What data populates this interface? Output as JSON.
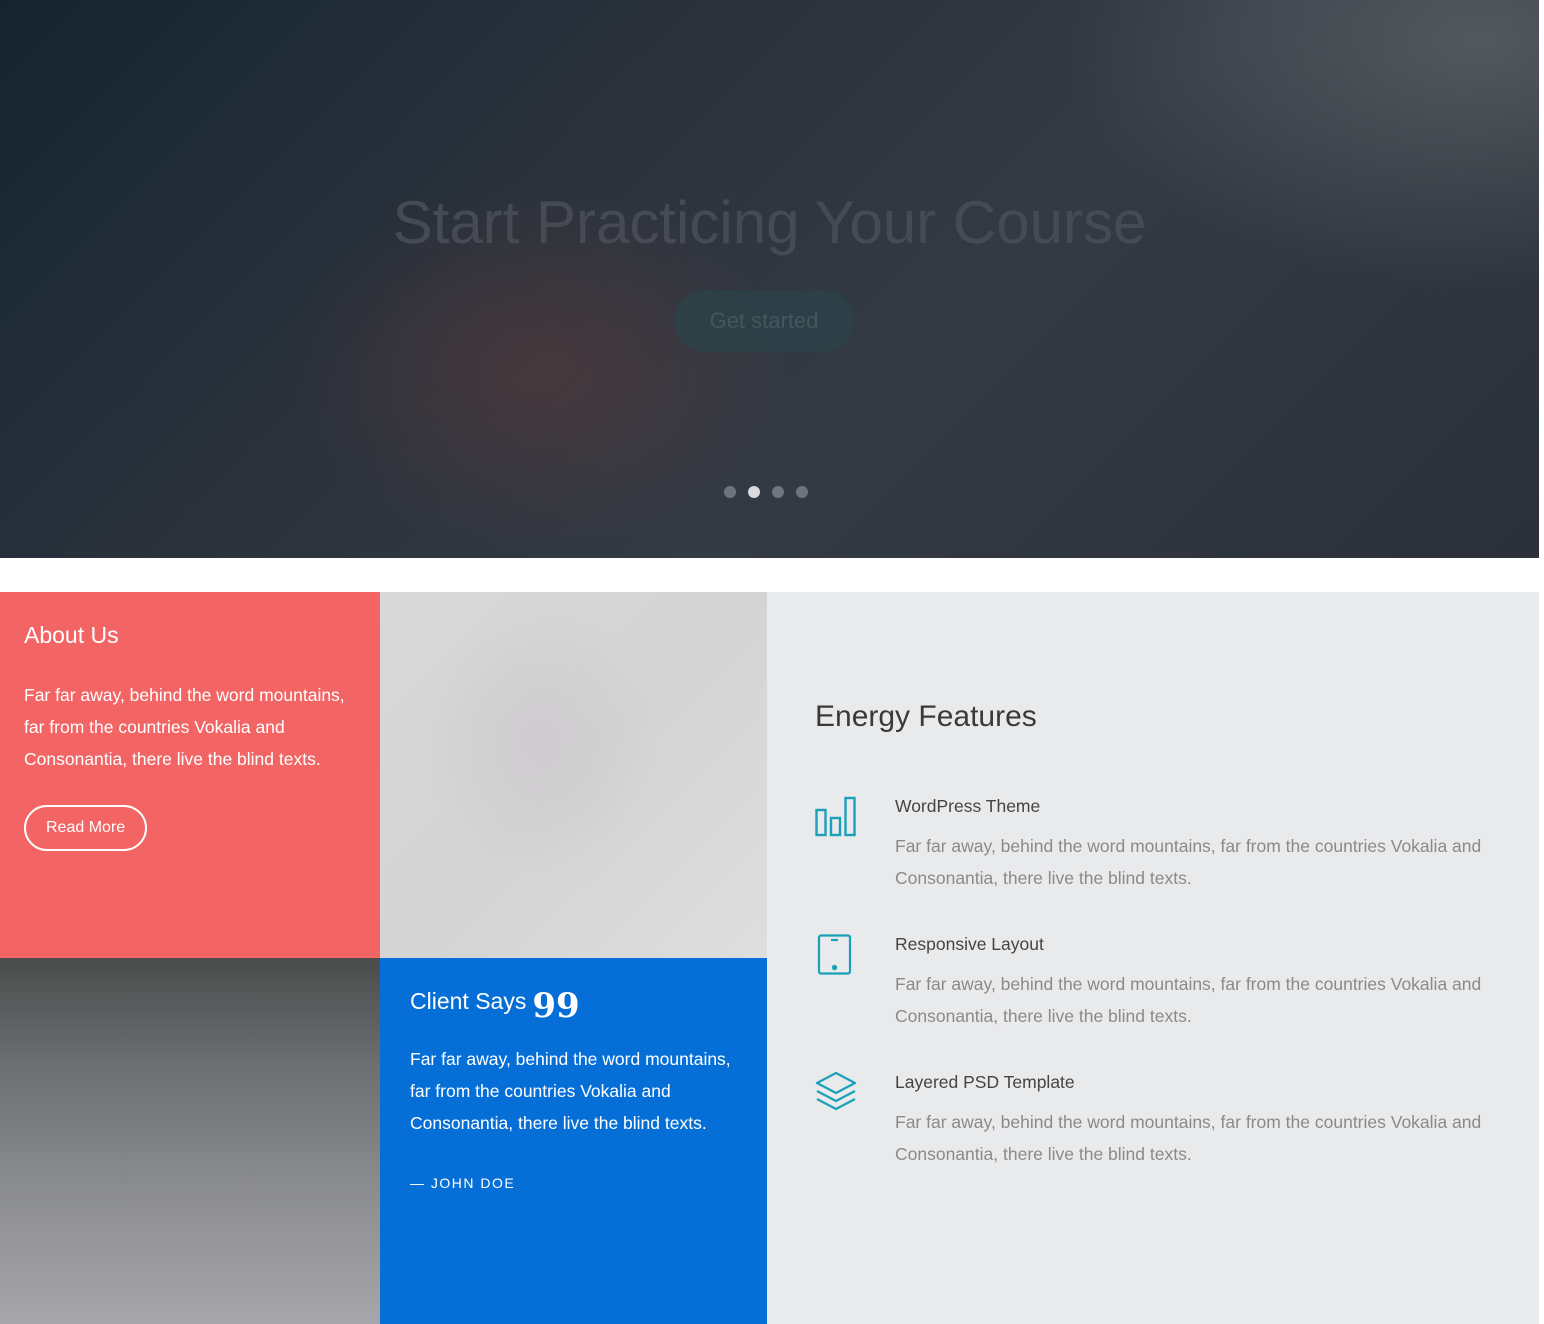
{
  "hero": {
    "title": "Start Practicing Your Course",
    "button_label": "Get started",
    "dots_count": 4,
    "active_dot": 2
  },
  "about": {
    "title": "About Us",
    "text": "Far far away, behind the word mountains, far from the countries Vokalia and Consonantia, there live the blind texts.",
    "button_label": "Read More"
  },
  "client": {
    "title": "Client Says",
    "quote_glyph": "99",
    "text": "Far far away, behind the word mountains, far from the countries Vokalia and Consonantia, there live the blind texts.",
    "author": "— JOHN DOE"
  },
  "features": {
    "title": "Energy Features",
    "items": [
      {
        "icon": "bar-chart-icon",
        "title": "WordPress Theme",
        "text": "Far far away, behind the word mountains, far from the countries Vokalia and Consonantia, there live the blind texts."
      },
      {
        "icon": "tablet-icon",
        "title": "Responsive Layout",
        "text": "Far far away, behind the word mountains, far from the countries Vokalia and Consonantia, there live the blind texts."
      },
      {
        "icon": "layers-icon",
        "title": "Layered PSD Template",
        "text": "Far far away, behind the word mountains, far from the countries Vokalia and Consonantia, there live the blind texts."
      }
    ]
  },
  "colors": {
    "about_bg": "#f36565",
    "client_bg": "#066fd7",
    "features_bg": "#e9eaec",
    "icon_accent": "#1aa0b8"
  }
}
